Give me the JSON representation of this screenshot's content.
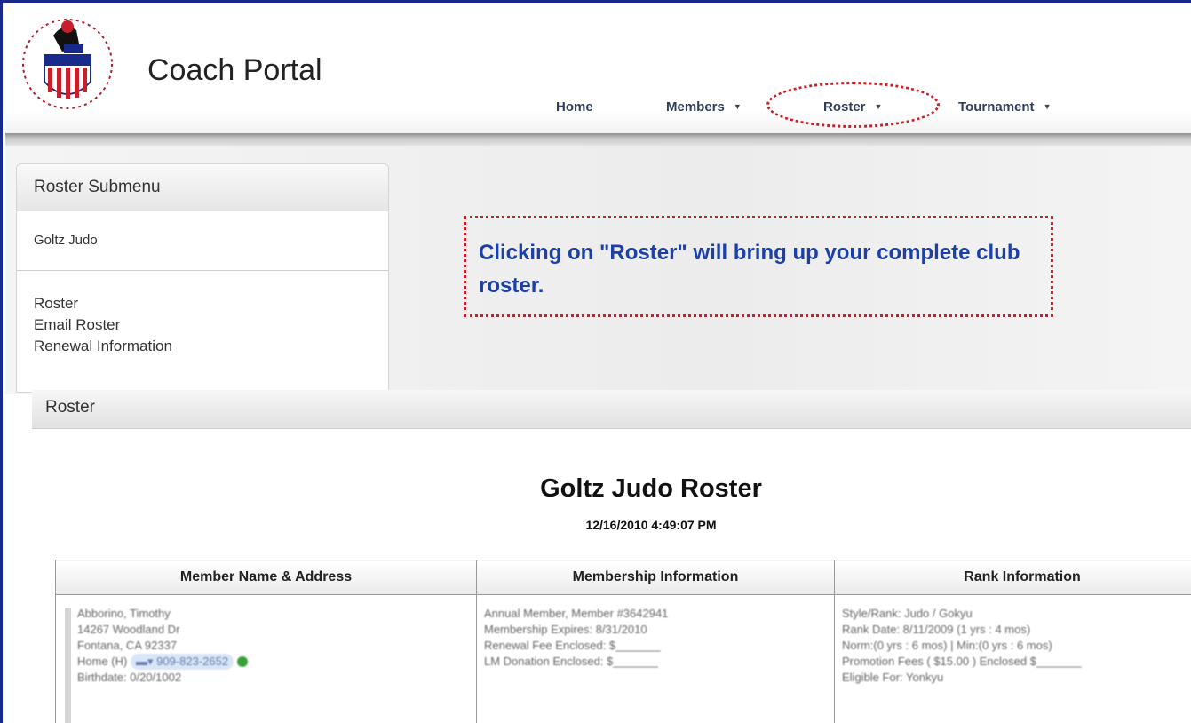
{
  "header": {
    "app_title": "Coach Portal",
    "logo_icon": "usja-shield-logo",
    "nav": [
      {
        "label": "Home",
        "has_dropdown": false
      },
      {
        "label": "Members",
        "has_dropdown": true
      },
      {
        "label": "Roster",
        "has_dropdown": true
      },
      {
        "label": "Tournament",
        "has_dropdown": true
      }
    ]
  },
  "submenu": {
    "title": "Roster Submenu",
    "club": "Goltz Judo",
    "links": [
      "Roster",
      "Email Roster",
      "Renewal Information"
    ]
  },
  "callout": {
    "text": "Clicking on \"Roster\" will bring up your complete club roster.",
    "color": "#1d3fa8",
    "border_color": "#c8202a"
  },
  "roster_section": {
    "title": "Roster"
  },
  "document": {
    "title": "Goltz Judo Roster",
    "date": "12/16/2010 4:49:07 PM",
    "columns": [
      "Member Name & Address",
      "Membership Information",
      "Rank Information"
    ],
    "rows": [
      {
        "member": [
          "Abborino, Timothy",
          "14267 Woodland Dr",
          "Fontana, CA 92337",
          "Home (H)",
          "909-823-2652",
          "Birthdate: 0/20/1002"
        ],
        "membership": [
          "Annual Member, Member #3642941",
          "Membership Expires: 8/31/2010",
          "Renewal Fee Enclosed: $_______",
          "LM Donation Enclosed: $_______"
        ],
        "rank": [
          "Style/Rank: Judo / Gokyu",
          "Rank Date: 8/11/2009 (1 yrs : 4 mos)",
          "Norm:(0 yrs : 6 mos) | Min:(0 yrs : 6 mos)",
          "Promotion Fees ( $15.00 ) Enclosed $_______",
          "Eligible For: Yonkyu"
        ]
      }
    ]
  }
}
